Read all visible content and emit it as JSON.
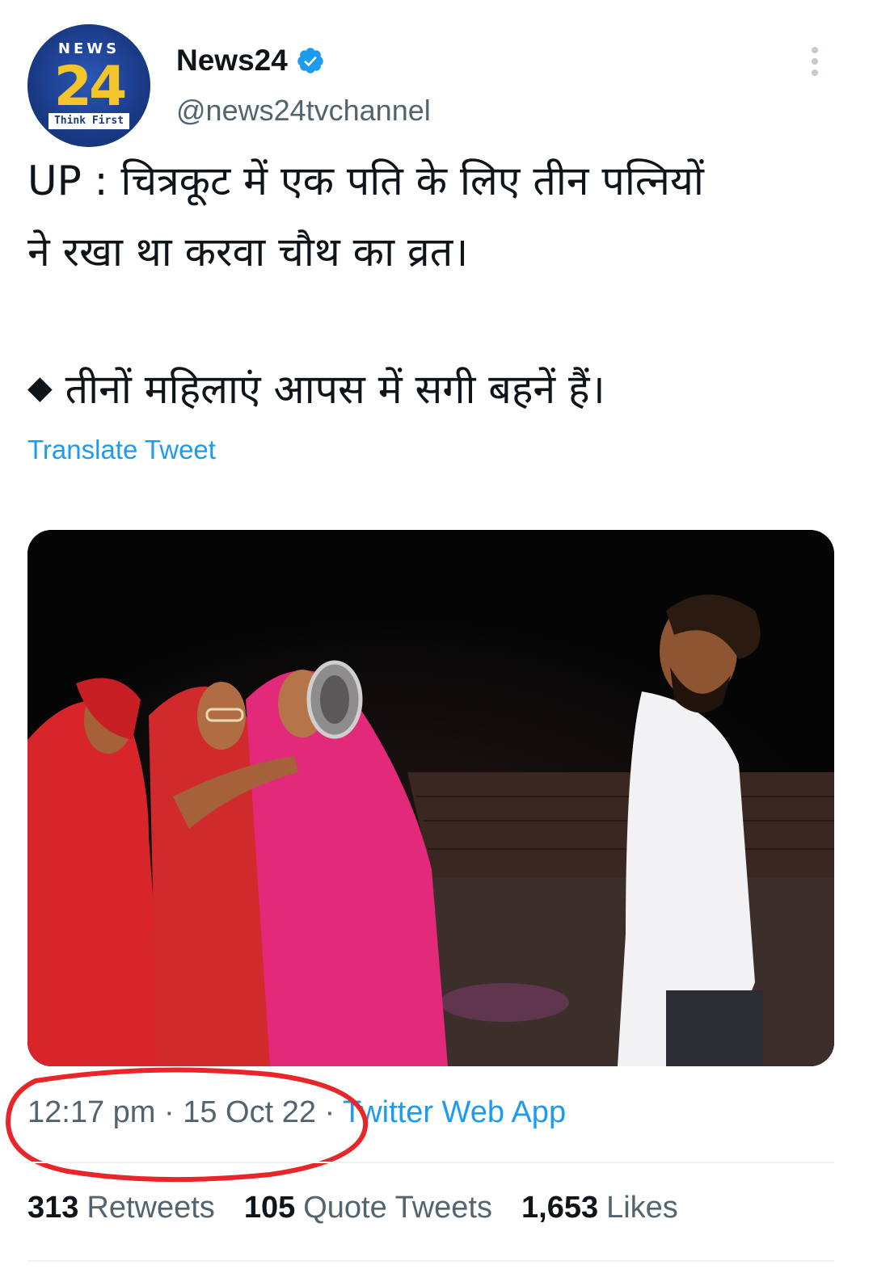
{
  "author": {
    "display_name": "News24",
    "handle": "@news24tvchannel",
    "avatar": {
      "brand_top": "NEWS",
      "brand_number": "24",
      "brand_tagline": "Think First"
    },
    "verified": true
  },
  "tweet": {
    "line1": "UP : चित्रकूट में एक पति के लिए तीन पत्नियों",
    "line2": "ने रखा था करवा चौथ का व्रत।",
    "bullet": "◆",
    "line3": "तीनों महिलाएं आपस में सगी बहनें हैं।",
    "translate_label": "Translate Tweet"
  },
  "timestamp": {
    "time": "12:17 pm",
    "separator": "·",
    "date": "15 Oct 22",
    "source": "Twitter Web App"
  },
  "stats": {
    "retweets": {
      "count": "313",
      "label": "Retweets"
    },
    "quotes": {
      "count": "105",
      "label": "Quote Tweets"
    },
    "likes": {
      "count": "1,653",
      "label": "Likes"
    }
  },
  "icons": {
    "verified": "verified-badge-icon",
    "more": "more-options-icon"
  },
  "colors": {
    "link": "#1d9bf0",
    "secondary_text": "#536471",
    "primary_text": "#0f1419",
    "annotation_circle": "#e8262a"
  }
}
